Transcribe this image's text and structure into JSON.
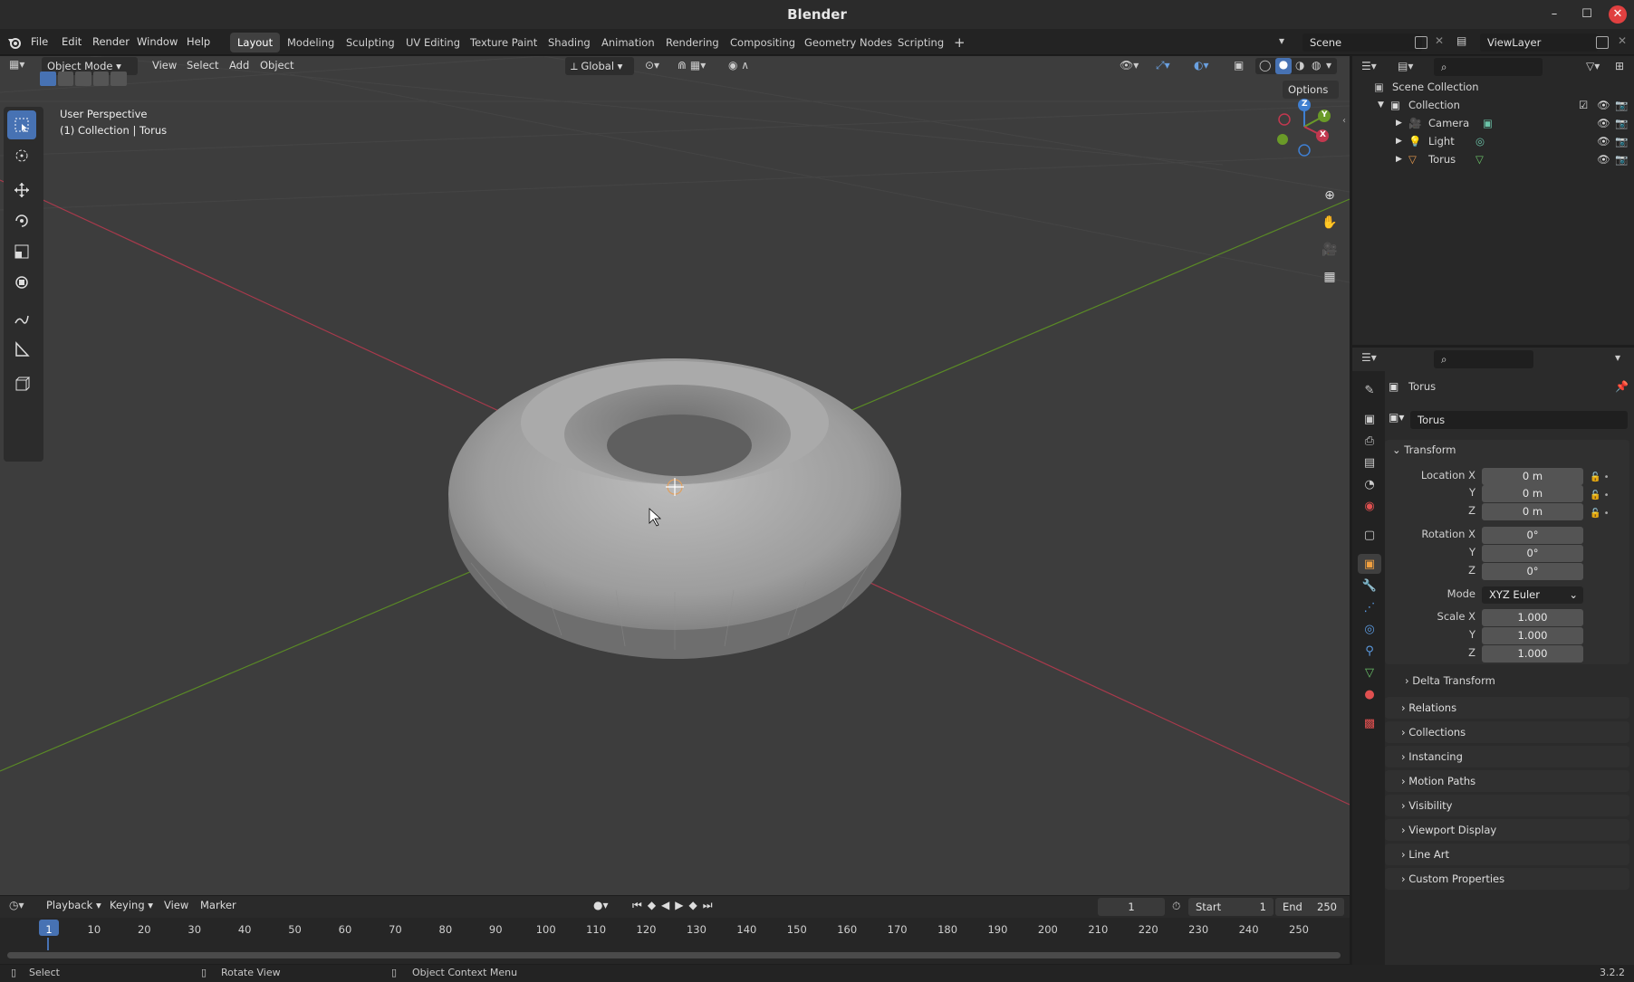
{
  "window": {
    "title": "Blender"
  },
  "menu": [
    "File",
    "Edit",
    "Render",
    "Window",
    "Help"
  ],
  "workspaces": [
    "Layout",
    "Modeling",
    "Sculpting",
    "UV Editing",
    "Texture Paint",
    "Shading",
    "Animation",
    "Rendering",
    "Compositing",
    "Geometry Nodes",
    "Scripting"
  ],
  "active_workspace": "Layout",
  "scene": {
    "name": "Scene",
    "view_layer": "ViewLayer"
  },
  "viewport": {
    "mode": "Object Mode",
    "menus": [
      "View",
      "Select",
      "Add",
      "Object"
    ],
    "orientation": "Global",
    "options_label": "Options",
    "overlay_title": "User Perspective",
    "overlay_subtitle": "(1) Collection | Torus",
    "gizmo_axes": {
      "x": "X",
      "y": "Y",
      "z": "Z"
    }
  },
  "outliner": {
    "root": "Scene Collection",
    "collection": "Collection",
    "items": [
      "Camera",
      "Light",
      "Torus"
    ]
  },
  "properties": {
    "object_name": "Torus",
    "data_name": "Torus",
    "transform_label": "Transform",
    "location_label": "Location X",
    "rotation_label": "Rotation X",
    "scale_label": "Scale X",
    "y_label": "Y",
    "z_label": "Z",
    "location": [
      "0 m",
      "0 m",
      "0 m"
    ],
    "rotation": [
      "0°",
      "0°",
      "0°"
    ],
    "mode_label": "Mode",
    "mode_value": "XYZ Euler",
    "scale": [
      "1.000",
      "1.000",
      "1.000"
    ],
    "delta": "Delta Transform",
    "panels": [
      "Relations",
      "Collections",
      "Instancing",
      "Motion Paths",
      "Visibility",
      "Viewport Display",
      "Line Art",
      "Custom Properties"
    ]
  },
  "timeline": {
    "menus": [
      "Playback",
      "Keying",
      "View",
      "Marker"
    ],
    "current_frame": "1",
    "start_label": "Start",
    "start": "1",
    "end_label": "End",
    "end": "250",
    "ticks": [
      "1",
      "10",
      "20",
      "30",
      "40",
      "50",
      "60",
      "70",
      "80",
      "90",
      "100",
      "110",
      "120",
      "130",
      "140",
      "150",
      "160",
      "170",
      "180",
      "190",
      "200",
      "210",
      "220",
      "230",
      "240",
      "250"
    ]
  },
  "status": {
    "left": "Select",
    "middle": "Rotate View",
    "right": "Object Context Menu",
    "version": "3.2.2"
  },
  "colors": {
    "accent": "#4772b3",
    "x_axis": "#c2384f",
    "y_axis": "#6a9a28",
    "z_axis": "#3f7fd1",
    "viewport_bg": "#3d3d3d"
  }
}
